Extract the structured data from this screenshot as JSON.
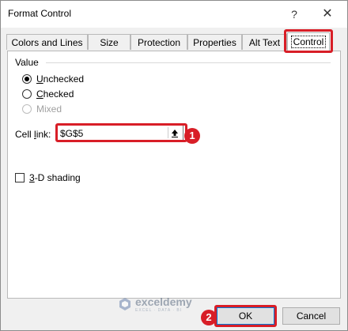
{
  "window": {
    "title": "Format Control",
    "help_glyph": "?",
    "close_glyph": "✕"
  },
  "tabs": [
    {
      "label": "Colors and Lines"
    },
    {
      "label": "Size"
    },
    {
      "label": "Protection"
    },
    {
      "label": "Properties"
    },
    {
      "label": "Alt Text"
    },
    {
      "label": "Control"
    }
  ],
  "control": {
    "group_label": "Value",
    "options": [
      {
        "underline": "U",
        "rest": "nchecked",
        "state": "checked"
      },
      {
        "underline": "C",
        "rest": "hecked",
        "state": "unchecked"
      },
      {
        "underline": "",
        "rest": "Mixed",
        "state": "disabled"
      }
    ],
    "cell_link": {
      "label_pre": "Cell ",
      "label_u": "l",
      "label_post": "ink:",
      "value": "$G$5"
    },
    "shading": {
      "underline": "3",
      "rest": "-D shading",
      "checked": false
    }
  },
  "buttons": {
    "ok": "OK",
    "cancel": "Cancel"
  },
  "badges": {
    "one": "1",
    "two": "2"
  },
  "watermark": {
    "title": "exceldemy",
    "subtitle": "EXCEL · DATA · BI"
  },
  "colors": {
    "highlight": "#d81e27",
    "default_button_border": "#0078d7"
  }
}
